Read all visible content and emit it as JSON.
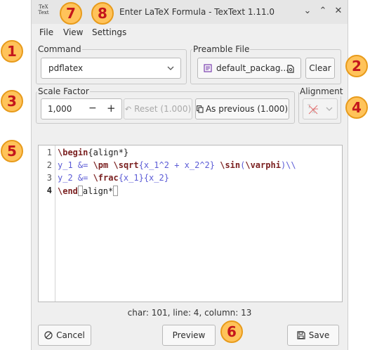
{
  "window": {
    "logo_line1": "TeX",
    "logo_line2": "Text",
    "title": "Enter LaTeX Formula - TexText 1.11.0",
    "controls": {
      "minimize": "⌄",
      "maximize": "⌃",
      "close": "✕"
    }
  },
  "menu": {
    "file": "File",
    "view": "View",
    "settings": "Settings"
  },
  "command": {
    "label": "Command",
    "value": "pdflatex"
  },
  "preamble": {
    "label": "Preamble File",
    "file": "default_packag...",
    "clear": "Clear"
  },
  "scale": {
    "label": "Scale Factor",
    "value": "1,000",
    "minus": "−",
    "plus": "+",
    "reset": "Reset (1.000)",
    "as_previous": "As previous (1.000)"
  },
  "alignment": {
    "label": "Alignment"
  },
  "editor": {
    "line_numbers": [
      "1",
      "2",
      "3",
      "4"
    ],
    "lines": [
      {
        "a": "\\begin",
        "b": "{align*}"
      },
      {
        "a": "y_1 &= ",
        "b": "\\pm",
        "c": " ",
        "d": "\\sqrt",
        "e": "{x_1^2 + x_2^2} ",
        "f": "\\sin",
        "g": "(",
        "h": "\\varphi",
        "i": ")\\\\"
      },
      {
        "a": "y_2 &= ",
        "b": "\\frac",
        "c": "{x_1}{x_2}"
      },
      {
        "a": "\\end",
        "b": "align*"
      }
    ]
  },
  "status": "char: 101, line: 4, column: 13",
  "buttons": {
    "cancel": "Cancel",
    "preview": "Preview",
    "save": "Save"
  },
  "annotations": [
    "1",
    "2",
    "3",
    "4",
    "5",
    "6",
    "7",
    "8"
  ],
  "colors": {
    "badge_fill": "#ffc35a",
    "badge_text": "#c4161c",
    "keyword": "#7a1f1f",
    "argument": "#5b5bd6"
  }
}
